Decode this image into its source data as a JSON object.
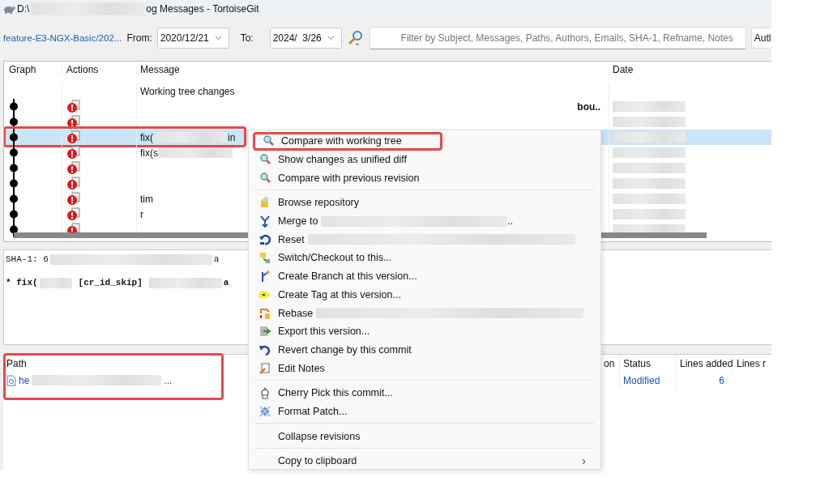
{
  "window": {
    "title_start": "D:\\",
    "title_end": "og Messages - TortoiseGit"
  },
  "toolbar": {
    "branch": "feature-E3-NGX-Basic/202...",
    "from_label": "From:",
    "from_date": "2020/12/21",
    "to_label": "To:",
    "to_date": "2024/  3/26",
    "filter_placeholder": "Filter by Subject, Messages, Paths, Authors, Emails, SHA-1, Refname, Notes",
    "author_button": "Autl"
  },
  "log": {
    "columns": [
      "Graph",
      "Actions",
      "Message",
      "Date"
    ],
    "rows": [
      {
        "kind": "worktree",
        "message": "Working tree changes",
        "selected": false
      },
      {
        "kind": "commit",
        "tail": "bou..",
        "selected": false
      },
      {
        "kind": "commit",
        "selected": false
      },
      {
        "kind": "commit",
        "message": "fix(",
        "tail": "in",
        "selected": true
      },
      {
        "kind": "commit",
        "message": "fix(s",
        "selected": false
      },
      {
        "kind": "commit",
        "selected": false
      },
      {
        "kind": "commit",
        "selected": false
      },
      {
        "kind": "commit",
        "tail": "tim",
        "selected": false
      },
      {
        "kind": "commit",
        "tail": "r",
        "selected": false
      },
      {
        "kind": "commit",
        "selected": false
      }
    ]
  },
  "details": {
    "sha_label": "SHA-1: 6",
    "sha_tail": "a",
    "subject_start": "* fix(",
    "subject_tag": "[cr_id_skip]",
    "subject_tail": "a"
  },
  "files": {
    "highlighted": true,
    "columns": [
      "Path",
      "on",
      "Status",
      "Lines added",
      "Lines r"
    ],
    "rows": [
      {
        "path": "he",
        "path_tail": "...",
        "status": "Modified",
        "lines_added": "6"
      }
    ]
  },
  "context_menu": {
    "items": [
      {
        "kind": "item",
        "label": "Compare with working tree",
        "highlighted": true
      },
      {
        "kind": "item",
        "label": "Show changes as unified diff",
        "highlighted": false
      },
      {
        "kind": "item",
        "label": "Compare with previous revision",
        "highlighted": false
      },
      {
        "kind": "separator"
      },
      {
        "kind": "item",
        "label": "Browse repository",
        "highlighted": false
      },
      {
        "kind": "item",
        "label": "Merge to",
        "blurred": true,
        "suffix": "..",
        "highlighted": false
      },
      {
        "kind": "item",
        "label": "Reset",
        "blurred": true,
        "highlighted": false
      },
      {
        "kind": "item",
        "label": "Switch/Checkout to this...",
        "highlighted": false
      },
      {
        "kind": "item",
        "label": "Create Branch at this version...",
        "highlighted": false
      },
      {
        "kind": "item",
        "label": "Create Tag at this version...",
        "highlighted": false
      },
      {
        "kind": "item",
        "label": "Rebase",
        "blurred": true,
        "highlighted": false
      },
      {
        "kind": "item",
        "label": "Export this version...",
        "highlighted": false
      },
      {
        "kind": "item",
        "label": "Revert change by this commit",
        "highlighted": false
      },
      {
        "kind": "item",
        "label": "Edit Notes",
        "highlighted": false
      },
      {
        "kind": "separator"
      },
      {
        "kind": "item",
        "label": "Cherry Pick this commit...",
        "highlighted": false
      },
      {
        "kind": "item",
        "label": "Format Patch...",
        "highlighted": false
      },
      {
        "kind": "separator"
      },
      {
        "kind": "item",
        "label": "Collapse revisions",
        "highlighted": false
      },
      {
        "kind": "separator"
      },
      {
        "kind": "submenu",
        "label": "Copy to clipboard",
        "arrow": "›",
        "highlighted": false
      }
    ]
  }
}
